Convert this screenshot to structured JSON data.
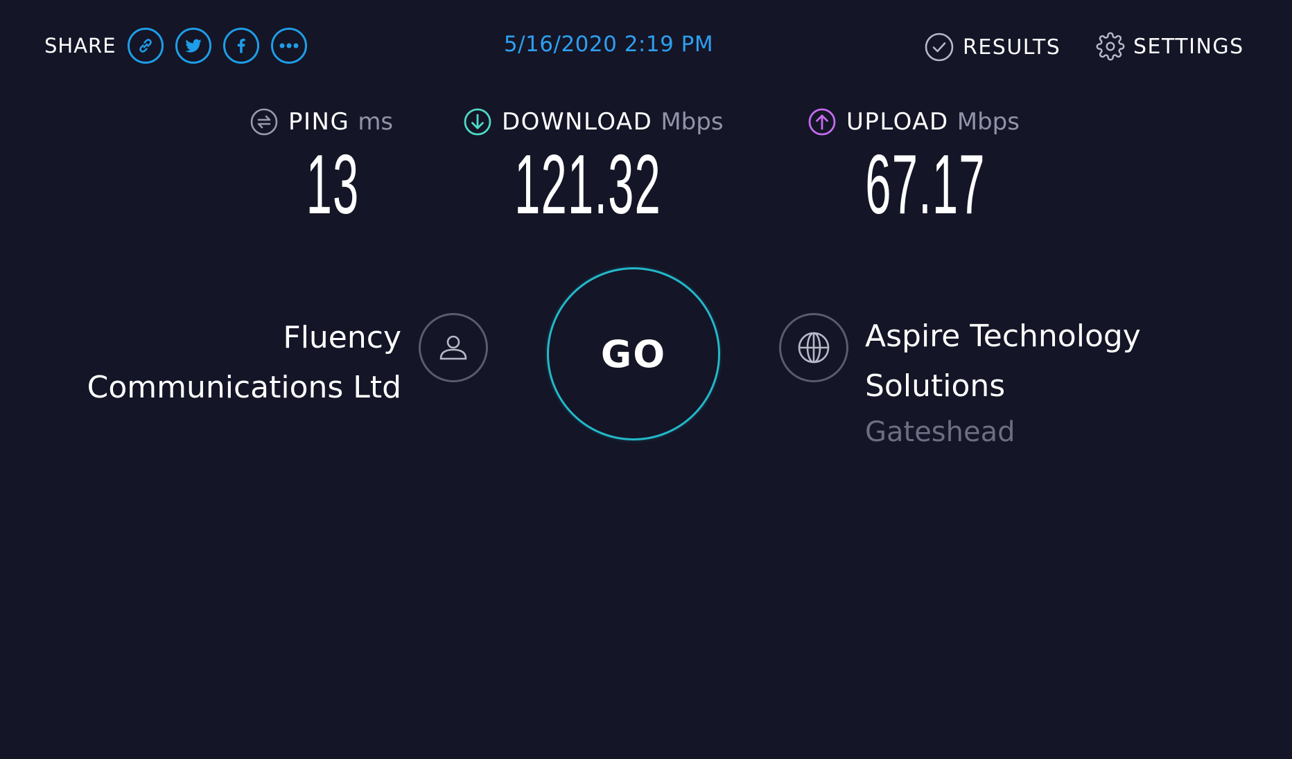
{
  "share": {
    "label": "SHARE",
    "buttons": [
      {
        "name": "link",
        "icon": "link-icon"
      },
      {
        "name": "twitter",
        "icon": "twitter-icon"
      },
      {
        "name": "facebook",
        "icon": "facebook-icon"
      },
      {
        "name": "more",
        "icon": "more-icon"
      }
    ]
  },
  "timestamp": "5/16/2020 2:19 PM",
  "nav": {
    "results_label": "RESULTS",
    "results_icon": "check-circle-icon",
    "settings_label": "SETTINGS",
    "settings_icon": "gear-icon"
  },
  "metrics": {
    "ping": {
      "label": "PING",
      "unit": "ms",
      "value": "13",
      "icon": "ping-icon",
      "icon_color": "#9a9cae"
    },
    "download": {
      "label": "DOWNLOAD",
      "unit": "Mbps",
      "value": "121.32",
      "icon": "download-arrow-icon",
      "icon_color": "#4fd9c8"
    },
    "upload": {
      "label": "UPLOAD",
      "unit": "Mbps",
      "value": "67.17",
      "icon": "upload-arrow-icon",
      "icon_color": "#c46cf0"
    }
  },
  "isp": {
    "line1": "Fluency",
    "line2": "Communications Ltd",
    "icon": "user-icon"
  },
  "go": {
    "label": "GO"
  },
  "server": {
    "line1": "Aspire Technology",
    "line2": "Solutions",
    "location": "Gateshead",
    "icon": "globe-icon"
  },
  "colors": {
    "background": "#141526",
    "accent_blue": "#1e9ee8",
    "go_ring": "#22b8c9",
    "muted_text": "#9193a8"
  }
}
